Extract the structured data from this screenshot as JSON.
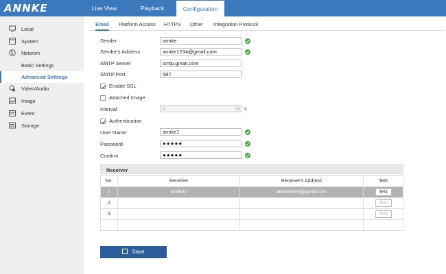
{
  "header": {
    "logo": "ANNKE",
    "tabs": [
      "Live View",
      "Playback",
      "Configuration"
    ]
  },
  "sidebar": {
    "items": [
      {
        "label": "Local",
        "icon": "monitor-icon"
      },
      {
        "label": "System",
        "icon": "system-icon"
      },
      {
        "label": "Network",
        "icon": "globe-icon"
      },
      {
        "label": "Basic Settings"
      },
      {
        "label": "Advanced Settings"
      },
      {
        "label": "Video/Audio",
        "icon": "video-audio-icon"
      },
      {
        "label": "Image",
        "icon": "image-icon"
      },
      {
        "label": "Event",
        "icon": "calendar-icon"
      },
      {
        "label": "Storage",
        "icon": "storage-icon"
      }
    ]
  },
  "subtabs": [
    "Email",
    "Platform Access",
    "HTTPS",
    "Other",
    "Integration Protocol"
  ],
  "form": {
    "sender_label": "Sender",
    "sender_value": "annke",
    "sender_address_label": "Sender's Address",
    "sender_address_value": "annke1234@gmail.com",
    "smtp_server_label": "SMTP Server",
    "smtp_server_value": "smtp.gmail.com",
    "smtp_port_label": "SMTP Port",
    "smtp_port_value": "587",
    "enable_ssl_label": "Enable SSL",
    "attached_image_label": "Attached Image",
    "interval_label": "Interval",
    "interval_value": "2",
    "interval_unit": "s",
    "authentication_label": "Authentication",
    "username_label": "User Name",
    "username_value": "annke1",
    "password_label": "Password",
    "password_value": "●●●●●",
    "confirm_label": "Confirm",
    "confirm_value": "●●●●●"
  },
  "receiver": {
    "title": "Receiver",
    "columns": [
      "No.",
      "Receiver",
      "Receiver's Address",
      "Test"
    ],
    "rows": [
      {
        "no": "1",
        "name": "annke2",
        "address": "annke3456@gmail.com",
        "test": "Test"
      },
      {
        "no": "2",
        "name": "",
        "address": "",
        "test": "Test"
      },
      {
        "no": "3",
        "name": "",
        "address": "",
        "test": "Test"
      }
    ]
  },
  "save_label": "Save",
  "colors": {
    "accent": "#3c78bc",
    "check": "#4aa841",
    "save": "#2b5d9c"
  }
}
